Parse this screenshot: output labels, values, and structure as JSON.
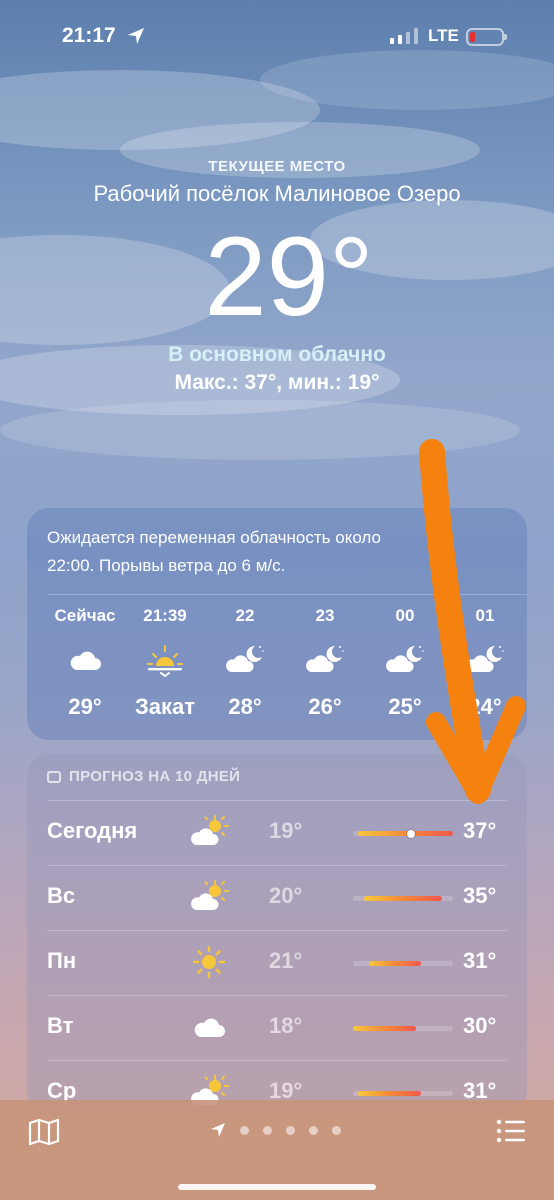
{
  "status": {
    "time": "21:17",
    "network": "LTE"
  },
  "header": {
    "location_label": "ТЕКУЩЕЕ МЕСТО",
    "location_name": "Рабочий посёлок Малиновое Озеро",
    "temperature": "29°",
    "condition": "В основном облачно",
    "hilo": "Макс.: 37°, мин.: 19°"
  },
  "hourly": {
    "summary_line1": "Ожидается переменная облачность около",
    "summary_line2": "22:00. Порывы ветра до 6 м/с.",
    "items": [
      {
        "time": "Сейчас",
        "icon": "cloud-icon",
        "temp": "29°"
      },
      {
        "time": "21:39",
        "icon": "sunset-icon",
        "temp": "Закат"
      },
      {
        "time": "22",
        "icon": "cloud-moon-icon",
        "temp": "28°"
      },
      {
        "time": "23",
        "icon": "cloud-moon-icon",
        "temp": "26°"
      },
      {
        "time": "00",
        "icon": "cloud-moon-icon",
        "temp": "25°"
      },
      {
        "time": "01",
        "icon": "cloud-moon-icon",
        "temp": "24°"
      }
    ]
  },
  "daily": {
    "header": "ПРОГНОЗ НА 10 ДНЕЙ",
    "range_scale": [
      18,
      37
    ],
    "days": [
      {
        "name": "Сегодня",
        "icon": "cloud-sun-icon",
        "min": "19°",
        "max": "37°",
        "low": 19,
        "high": 37,
        "current": 29
      },
      {
        "name": "Вс",
        "icon": "cloud-sun-icon",
        "min": "20°",
        "max": "35°",
        "low": 20,
        "high": 35
      },
      {
        "name": "Пн",
        "icon": "sun-icon",
        "min": "21°",
        "max": "31°",
        "low": 21,
        "high": 31
      },
      {
        "name": "Вт",
        "icon": "cloud-icon",
        "min": "18°",
        "max": "30°",
        "low": 18,
        "high": 30
      },
      {
        "name": "Ср",
        "icon": "cloud-sun-icon",
        "min": "19°",
        "max": "31°",
        "low": 19,
        "high": 31
      }
    ]
  },
  "bottom": {
    "page_count": 5
  }
}
